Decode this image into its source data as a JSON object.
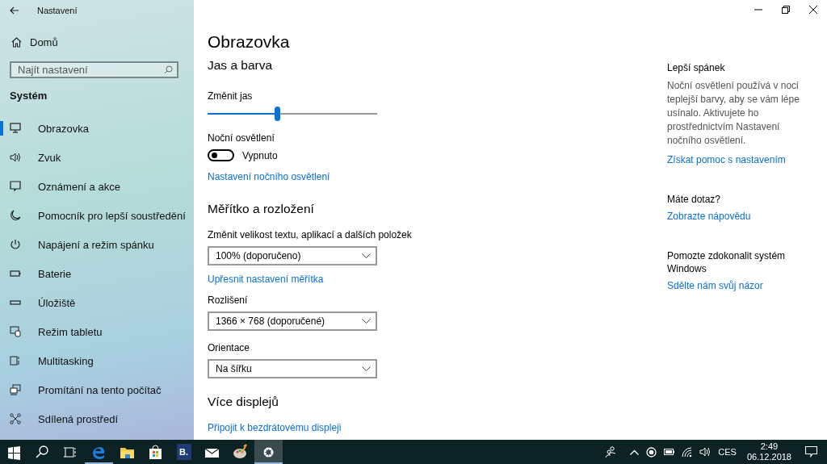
{
  "window": {
    "title": "Nastavení"
  },
  "sidebar": {
    "home": "Domů",
    "search": {
      "placeholder": "Najít nastavení"
    },
    "section": "Systém",
    "items": [
      {
        "label": "Obrazovka",
        "selected": true
      },
      {
        "label": "Zvuk",
        "selected": false
      },
      {
        "label": "Oznámení a akce",
        "selected": false
      },
      {
        "label": "Pomocník pro lepší soustředění",
        "selected": false
      },
      {
        "label": "Napájení a režim spánku",
        "selected": false
      },
      {
        "label": "Baterie",
        "selected": false
      },
      {
        "label": "Úložiště",
        "selected": false
      },
      {
        "label": "Režim tabletu",
        "selected": false
      },
      {
        "label": "Multitasking",
        "selected": false
      },
      {
        "label": "Promítání na tento počítač",
        "selected": false
      },
      {
        "label": "Sdílená prostředí",
        "selected": false
      }
    ]
  },
  "main": {
    "title": "Obrazovka",
    "sections": [
      {
        "heading": "Jas a barva",
        "controls": [
          {
            "kind": "slider",
            "label": "Změnit jas",
            "level": 0.41
          },
          {
            "kind": "toggle",
            "label": "Noční osvětlení",
            "on": false,
            "state": "Vypnuto"
          },
          {
            "kind": "link",
            "text": "Nastavení nočního osvětlení"
          }
        ]
      },
      {
        "heading": "Měřítko a rozložení",
        "controls": [
          {
            "kind": "dropdown",
            "label": "Změnit velikost textu, aplikací a dalších položek",
            "value": "100% (doporučeno)"
          },
          {
            "kind": "link",
            "text": "Upřesnit nastavení měřítka"
          },
          {
            "kind": "dropdown",
            "label": "Rozlišení",
            "value": "1366 × 768 (doporučené)"
          },
          {
            "kind": "dropdown",
            "label": "Orientace",
            "value": "Na šířku"
          }
        ]
      },
      {
        "heading": "Více displejů",
        "controls": [
          {
            "kind": "link",
            "text": "Připojit k bezdrátovému displeji"
          }
        ]
      }
    ]
  },
  "side_panel": [
    {
      "heading": "Lepší spánek",
      "text": "Noční osvětlení používá v noci teplejší barvy, aby se vám lépe usínalo. Aktivujete ho prostřednictvím Nastavení nočního osvětlení.",
      "link": "Získat pomoc s nastavením"
    },
    {
      "heading": "Máte dotaz?",
      "link": "Zobrazte nápovědu"
    },
    {
      "heading": "Pomozte zdokonalit systém Windows",
      "link": "Sdělte nám svůj názor"
    }
  ],
  "taskbar": {
    "apps": [
      {
        "kind": "start",
        "running": false,
        "active": false
      },
      {
        "kind": "search",
        "running": false,
        "active": false
      },
      {
        "kind": "taskview",
        "running": false,
        "active": false
      },
      {
        "kind": "edge",
        "running": true,
        "active": false
      },
      {
        "kind": "explorer",
        "running": false,
        "active": false
      },
      {
        "kind": "store",
        "running": false,
        "active": false
      },
      {
        "kind": "booking",
        "text": "B.",
        "running": false,
        "active": false
      },
      {
        "kind": "mail",
        "running": false,
        "active": false
      },
      {
        "kind": "paint",
        "running": false,
        "active": false
      },
      {
        "kind": "settings",
        "running": true,
        "active": true
      }
    ],
    "language": "CES",
    "time": "2:49",
    "date": "06.12.2018"
  }
}
